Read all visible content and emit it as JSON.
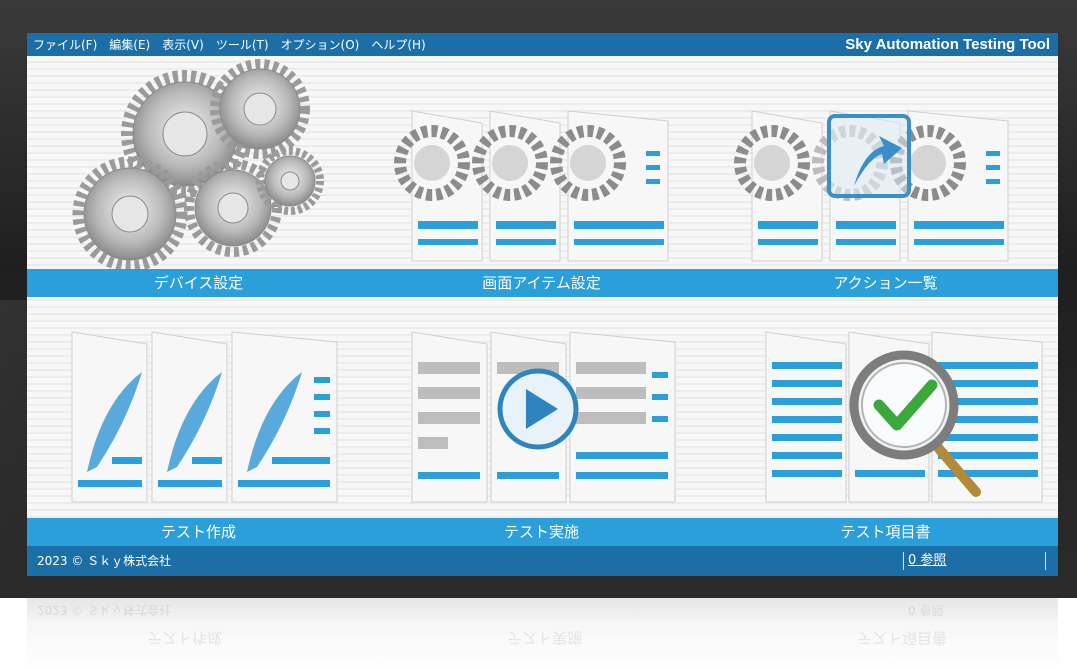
{
  "menu": {
    "items": [
      "ファイル(F)",
      "編集(E)",
      "表示(V)",
      "ツール(T)",
      "オプション(O)",
      "ヘルプ(H)"
    ]
  },
  "app_title": "Sky Automation Testing Tool",
  "tiles": {
    "device_settings": {
      "label": "デバイス設定",
      "icon": "gears-icon"
    },
    "screen_item_settings": {
      "label": "画面アイテム設定",
      "icon": "screen-items-icon"
    },
    "action_list": {
      "label": "アクション一覧",
      "icon": "action-list-icon"
    },
    "test_create": {
      "label": "テスト作成",
      "icon": "quill-pages-icon"
    },
    "test_run": {
      "label": "テスト実施",
      "icon": "play-pages-icon"
    },
    "test_items": {
      "label": "テスト項目書",
      "icon": "magnifier-check-icon"
    }
  },
  "status": {
    "copyright": "2023 © Ｓｋｙ株式会社",
    "reference_link": "0 参照"
  },
  "colors": {
    "menu_bar": "#1b6fa6",
    "label_band": "#2a9fd9",
    "accent_blue": "#2a9fd9",
    "check_green": "#3aa83a"
  }
}
